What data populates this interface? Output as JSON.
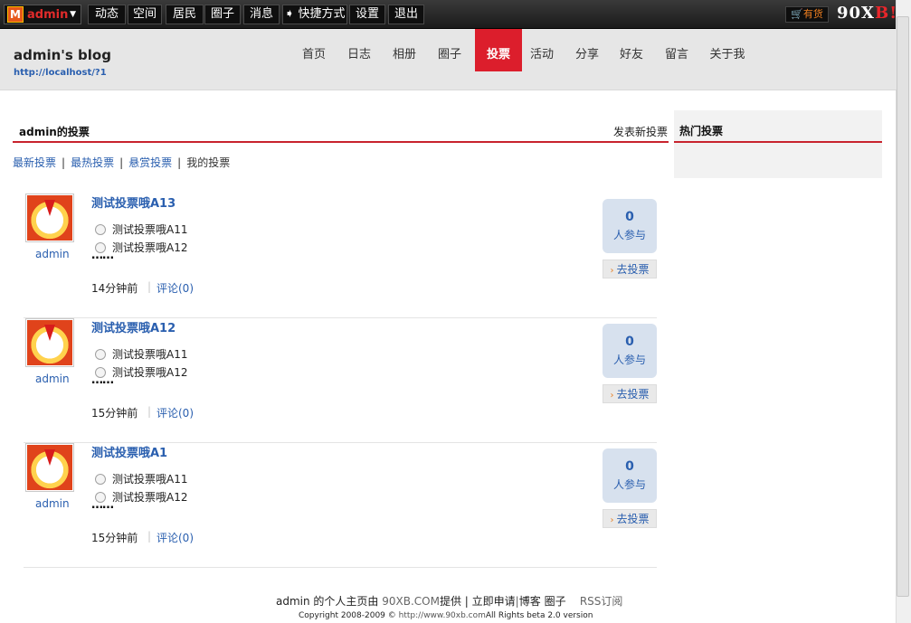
{
  "topbar": {
    "username": "admin",
    "logo_letter": "M",
    "items": [
      "动态",
      "空间",
      "居民",
      "圈子",
      "消息",
      "➧ 快捷方式",
      "设置",
      "退出"
    ],
    "shop_label": "有货",
    "brand_prefix": "90X",
    "brand_accent": "B!",
    "colors": {
      "bar": "#1b1b1b",
      "username": "#e12b2b",
      "brand_accent": "#e8262b"
    }
  },
  "header": {
    "blog_title": "admin's blog",
    "blog_url": "http://localhost/?1",
    "nav": [
      "首页",
      "日志",
      "相册",
      "圈子",
      "投票",
      "活动",
      "分享",
      "好友",
      "留言",
      "关于我"
    ],
    "active_nav": "投票",
    "colors": {
      "active": "#dc1e2c",
      "background": "#e6e6e6"
    }
  },
  "main": {
    "section_title": "admin的投票",
    "new_vote_link": "发表新投票",
    "subnav": {
      "latest": "最新投票",
      "hottest": "最热投票",
      "reward": "悬赏投票",
      "mine": "我的投票",
      "separator": "|"
    },
    "polls": [
      {
        "user": "admin",
        "title": "测试投票哦A13",
        "options": [
          "测试投票哦A11",
          "测试投票哦A12"
        ],
        "more": "……",
        "time": "14分钟前",
        "comment": "评论(0)",
        "count": "0",
        "count_label": "人参与",
        "vote_button": "去投票"
      },
      {
        "user": "admin",
        "title": "测试投票哦A12",
        "options": [
          "测试投票哦A11",
          "测试投票哦A12"
        ],
        "more": "……",
        "time": "15分钟前",
        "comment": "评论(0)",
        "count": "0",
        "count_label": "人参与",
        "vote_button": "去投票"
      },
      {
        "user": "admin",
        "title": "测试投票哦A1",
        "options": [
          "测试投票哦A11",
          "测试投票哦A12"
        ],
        "more": "……",
        "time": "15分钟前",
        "comment": "评论(0)",
        "count": "0",
        "count_label": "人参与",
        "vote_button": "去投票"
      }
    ],
    "divider": "|"
  },
  "sidebar": {
    "title": "热门投票"
  },
  "footer": {
    "owner_text": "admin 的个人主页由",
    "provider": "90XB.COM",
    "provided_by": "提供 |",
    "apply_link": "立即申请",
    "sep": "|",
    "bokee": "博客",
    "circle": "圈子",
    "rss": "RSS订阅",
    "copyright_prefix": "Copyright 2008-2009 © ",
    "copyright_url": "http://www.90xb.com",
    "copyright_suffix": "All Rights beta 2.0 version"
  },
  "icons": {
    "shop": "cart-icon",
    "vote_arrow": "arrow-right-icon",
    "radio": "radio-icon"
  }
}
